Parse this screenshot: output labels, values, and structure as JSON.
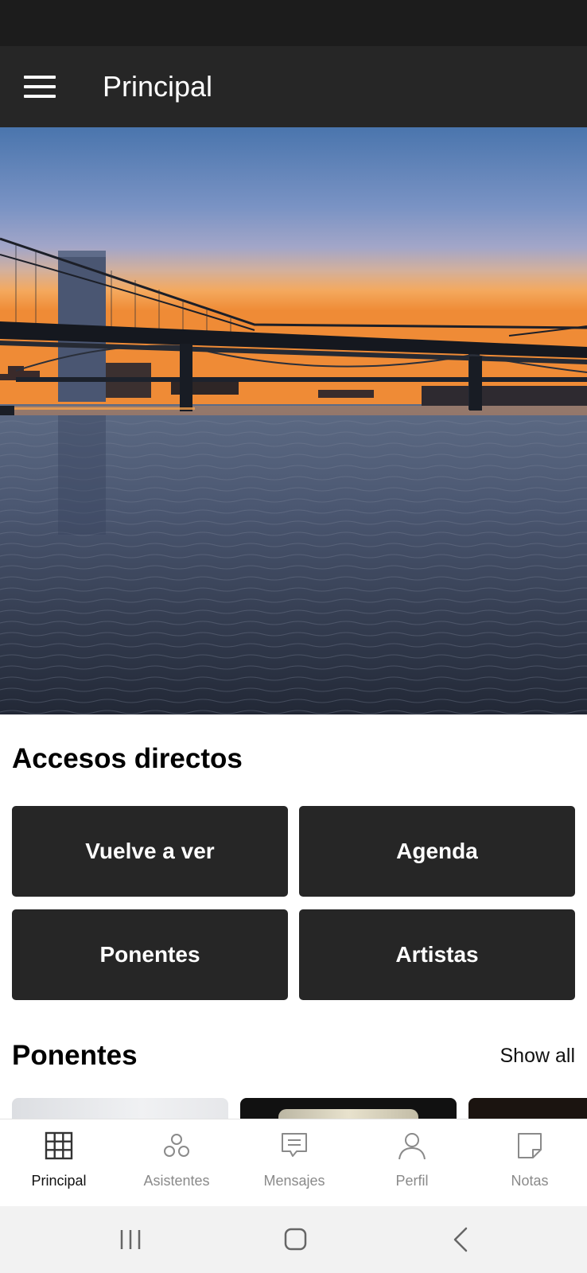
{
  "app_bar": {
    "title": "Principal",
    "menu_icon": "hamburger-menu-icon"
  },
  "hero": {
    "description": "bridge-at-sunset-photo"
  },
  "shortcuts": {
    "title": "Accesos directos",
    "items": [
      {
        "label": "Vuelve a ver"
      },
      {
        "label": "Agenda"
      },
      {
        "label": "Ponentes"
      },
      {
        "label": "Artistas"
      }
    ]
  },
  "speakers": {
    "title": "Ponentes",
    "show_all": "Show all"
  },
  "bottom_nav": {
    "items": [
      {
        "label": "Principal",
        "icon": "grid-icon",
        "active": true
      },
      {
        "label": "Asistentes",
        "icon": "people-circles-icon",
        "active": false
      },
      {
        "label": "Mensajes",
        "icon": "message-icon",
        "active": false
      },
      {
        "label": "Perfil",
        "icon": "person-icon",
        "active": false
      },
      {
        "label": "Notas",
        "icon": "note-icon",
        "active": false
      }
    ]
  },
  "system_nav": {
    "items": [
      {
        "icon": "recent-apps-icon"
      },
      {
        "icon": "home-icon"
      },
      {
        "icon": "back-icon"
      }
    ]
  },
  "colors": {
    "app_bar": "#262626",
    "status_bar": "#1c1c1c",
    "shortcut_bg": "#262626",
    "active_nav": "#111111",
    "inactive_nav": "#8a8a8a"
  }
}
